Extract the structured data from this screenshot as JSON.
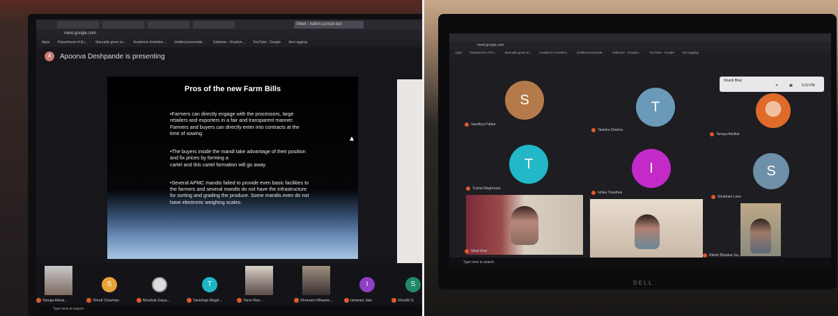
{
  "left": {
    "browser": {
      "tabs": [
        "",
        "",
        "",
        "",
        "Meet - hafxm-zzmze-bzr"
      ],
      "url": "meet.google.com",
      "bookmarks": [
        "Apps",
        "Department of Ec...",
        "Manually given ar...",
        "Academic Activities...",
        "Untitled presentati...",
        "Gallerian - Roadyn...",
        "YouTube - Google",
        "Anti ragging"
      ]
    },
    "presenter": {
      "initial": "A",
      "text": "Apoorva Deshpande is presenting"
    },
    "slide": {
      "title": "Pros of the new Farm Bills",
      "paragraphs": [
        "•Farmers can directly engage with the processors, large retailers and exporters in a fair and transparent manner.\nFarmers and buyers can directly enter into contracts at the time of sowing.",
        "•The buyers inside the mandi take advantage of their position and fix prices by forming a\ncartel and this cartel formation will go away.",
        "•Several APMC mandis failed to provide even basic facilities to the farmers and several mandis do not have the infrastructure for sorting and grading the produce. Some mandis even do not have electronic weighing scales."
      ]
    },
    "participants": [
      {
        "name": "Tanuja Advai...",
        "type": "photo",
        "initial": ""
      },
      {
        "name": "Shruti Chavhan",
        "type": "circle",
        "initial": "S",
        "color": "#e8a33a"
      },
      {
        "name": "Mrudula Gaya...",
        "type": "photo",
        "initial": ""
      },
      {
        "name": "Tanishqa Wagh...",
        "type": "circle",
        "initial": "T",
        "color": "#1fb6c8"
      },
      {
        "name": "Tanvi Ran...",
        "type": "photo",
        "initial": ""
      },
      {
        "name": "Shravani Mhaske...",
        "type": "photo",
        "initial": ""
      },
      {
        "name": "Isharani Jain",
        "type": "circle",
        "initial": "I",
        "color": "#8e3fc4"
      },
      {
        "name": "Shruthi S",
        "type": "circle",
        "initial": "S",
        "color": "#1f8a68"
      }
    ],
    "taskbar": {
      "search": "Type here to search"
    }
  },
  "right": {
    "browser": {
      "url": "meet.google.com",
      "bookmarks": [
        "Apps",
        "Department of Ec...",
        "Manually given ar...",
        "Academic Activities...",
        "Untitled presentati...",
        "Gallerian - Roadyn...",
        "YouTube - Google",
        "Anti ragging"
      ]
    },
    "controls": {
      "you_label": "Shanti Bhat",
      "time": "5:32 PM"
    },
    "participants": [
      {
        "name": "Sandhya Patkar",
        "initial": "S",
        "color": "#b57a4a",
        "type": "circle"
      },
      {
        "name": "Tanisha Sharma",
        "initial": "T",
        "color": "#6a9ab8",
        "type": "circle"
      },
      {
        "name": "Tanaya Advikar",
        "initial": "",
        "color": "#e06a2a",
        "type": "photo"
      },
      {
        "name": "Tushal Waghmare",
        "initial": "T",
        "color": "#22b8c8",
        "type": "circle"
      },
      {
        "name": "Ishika Tripathee",
        "initial": "I",
        "color": "#c42ac8",
        "type": "circle"
      },
      {
        "name": "Shubham Lohe",
        "initial": "S",
        "color": "#6e8fa8",
        "type": "circle"
      },
      {
        "name": "Mitali Wad",
        "initial": "",
        "color": "#a07a68",
        "type": "video"
      },
      {
        "name": "",
        "initial": "",
        "color": "#c9b8a6",
        "type": "video"
      },
      {
        "name": "Ritesh Bhaskar Ga...",
        "initial": "",
        "color": "#8a8a7c",
        "type": "video"
      }
    ],
    "taskbar": {
      "search": "Type here to search"
    },
    "brand": "DELL"
  }
}
